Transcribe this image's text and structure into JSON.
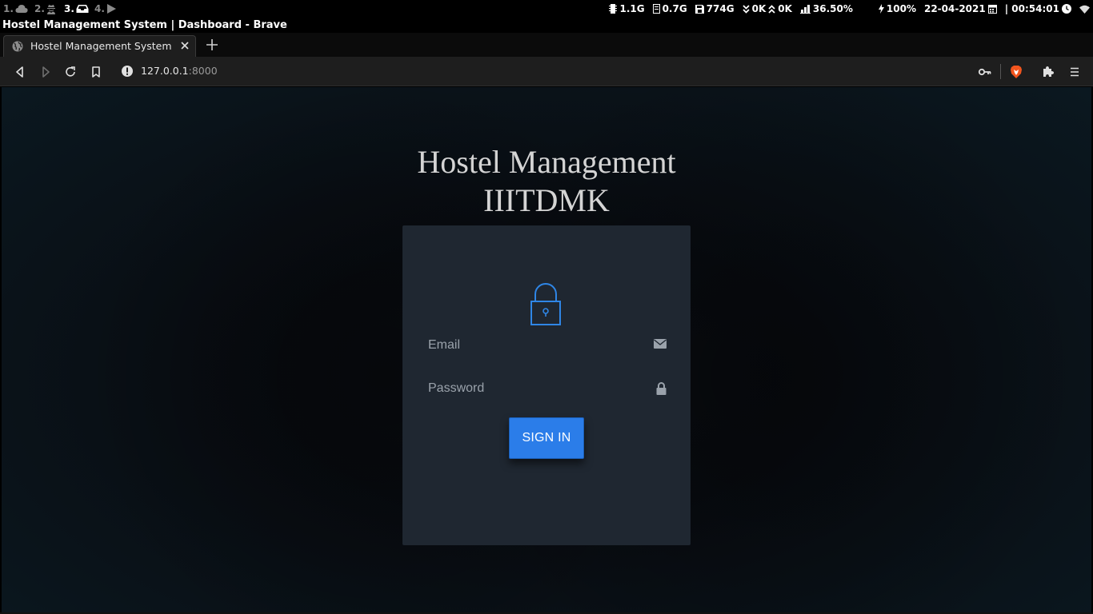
{
  "system_bar": {
    "workspaces": [
      {
        "label": "1.",
        "icon": "cloud-icon"
      },
      {
        "label": "2.",
        "icon": "user-secret-icon"
      },
      {
        "label": "3.",
        "icon": "inbox-icon"
      },
      {
        "label": "4.",
        "icon": "play-icon"
      }
    ],
    "active_workspace": 3,
    "stats": {
      "memory": "1.1G",
      "disk_used": "0.7G",
      "disk_free": "774G",
      "net_down": "0K",
      "net_up": "0K",
      "cpu": "36.50%",
      "battery": "100%",
      "date": "22-04-2021",
      "time": "| 00:54:01"
    }
  },
  "window": {
    "title": "Hostel Management System | Dashboard - Brave"
  },
  "browser": {
    "tab_title": "Hostel Management System | Dashboard",
    "url_host": "127.0.0.1",
    "url_port": ":8000"
  },
  "login": {
    "heading_line1": "Hostel Management",
    "heading_line2": "IIITDMK",
    "email_placeholder": "Email",
    "password_placeholder": "Password",
    "submit_label": "SIGN IN"
  },
  "colors": {
    "accent": "#2b7de9",
    "card": "#1f2731",
    "lock_icon": "#2f86e6"
  }
}
